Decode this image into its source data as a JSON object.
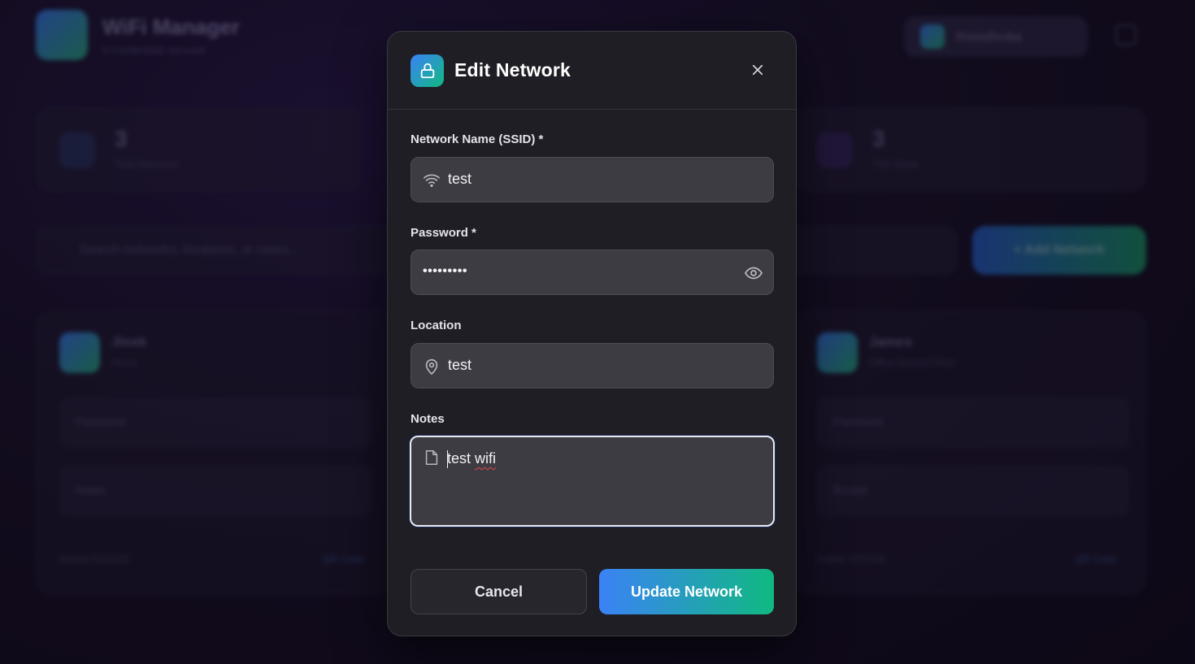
{
  "background": {
    "app_title": "WiFi Manager",
    "app_subtitle": "0 Credentials secured",
    "user_name": "thisisdhruba",
    "stats": [
      {
        "value": "3",
        "label": "Total Networks"
      },
      {
        "value": "3",
        "label": "This Week"
      }
    ],
    "search_placeholder": "Search networks, locations, or notes...",
    "add_button": "+ Add Network",
    "cards": [
      {
        "name": "Jinxk",
        "sub": "Home",
        "password_label": "Password",
        "notes_label": "Notes",
        "footer": "Added 3/2/2025",
        "qr": "QR Code"
      },
      {
        "name": "James",
        "sub": "Office Ground Floor",
        "password_label": "Password",
        "notes_label": "Router",
        "footer": "Added 3/2/2025",
        "qr": "QR Code"
      }
    ]
  },
  "modal": {
    "title": "Edit Network",
    "icon": "lock-icon",
    "ssid": {
      "label": "Network Name (SSID) *",
      "value": "test",
      "icon": "wifi-icon"
    },
    "password": {
      "label": "Password *",
      "masked_value": "•••••••••",
      "icon": "eye-icon"
    },
    "location": {
      "label": "Location",
      "value": "test",
      "icon": "map-pin-icon"
    },
    "notes": {
      "label": "Notes",
      "value_first": "test",
      "value_misspelled": "wifi",
      "icon": "file-icon"
    },
    "cancel_label": "Cancel",
    "submit_label": "Update Network"
  },
  "colors": {
    "accent_start": "#3b82f6",
    "accent_end": "#10b981",
    "modal_bg": "#1f1e24",
    "input_bg": "#3d3c42"
  }
}
